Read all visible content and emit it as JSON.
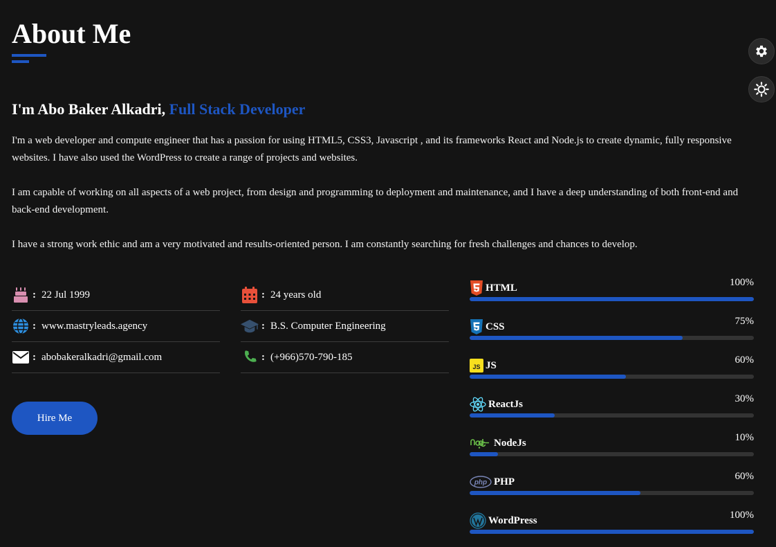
{
  "header": {
    "title": "About Me"
  },
  "intro": {
    "name_text": "I'm Abo Baker Alkadri,",
    "role_text": "Full Stack Developer"
  },
  "paragraphs": [
    "I'm a web developer and compute engineer that has a passion for using HTML5, CSS3, Javascript , and its frameworks React and Node.js to create dynamic, fully responsive websites. I have also used the WordPress to create a range of projects and websites.",
    "I am capable of working on all aspects of a web project, from design and programming to deployment and maintenance, and I have a deep understanding of both front-end and back-end development.",
    "I have a strong work ethic and am a very motivated and results-oriented person. I am constantly searching for fresh challenges and chances to develop."
  ],
  "info": {
    "col1": [
      {
        "icon": "birthday-cake-icon",
        "value": "22 Jul 1999"
      },
      {
        "icon": "globe-icon",
        "value": "www.mastryleads.agency"
      },
      {
        "icon": "envelope-icon",
        "value": "abobakeralkadri@gmail.com"
      }
    ],
    "col2": [
      {
        "icon": "calendar-icon",
        "value": "24 years old"
      },
      {
        "icon": "graduation-cap-icon",
        "value": "B.S. Computer Engineering"
      },
      {
        "icon": "phone-icon",
        "value": "(+966)570-790-185"
      }
    ],
    "colon": ":"
  },
  "hire_button": {
    "label": "Hire Me"
  },
  "skills": [
    {
      "name": "HTML",
      "percent_text": "100%",
      "level": 1.0,
      "icon": "html5-icon"
    },
    {
      "name": "CSS",
      "percent_text": "75%",
      "level": 0.75,
      "icon": "css3-icon"
    },
    {
      "name": "JS",
      "percent_text": "60%",
      "level": 0.55,
      "icon": "javascript-icon"
    },
    {
      "name": "ReactJs",
      "percent_text": "30%",
      "level": 0.3,
      "icon": "react-icon"
    },
    {
      "name": "NodeJs",
      "percent_text": "10%",
      "level": 0.1,
      "icon": "nodejs-icon"
    },
    {
      "name": "PHP",
      "percent_text": "60%",
      "level": 0.6,
      "icon": "php-icon"
    },
    {
      "name": "WordPress",
      "percent_text": "100%",
      "level": 1.0,
      "icon": "wordpress-icon"
    }
  ],
  "colors": {
    "accent": "#1e56c2",
    "background": "#141414",
    "track": "#333333"
  }
}
